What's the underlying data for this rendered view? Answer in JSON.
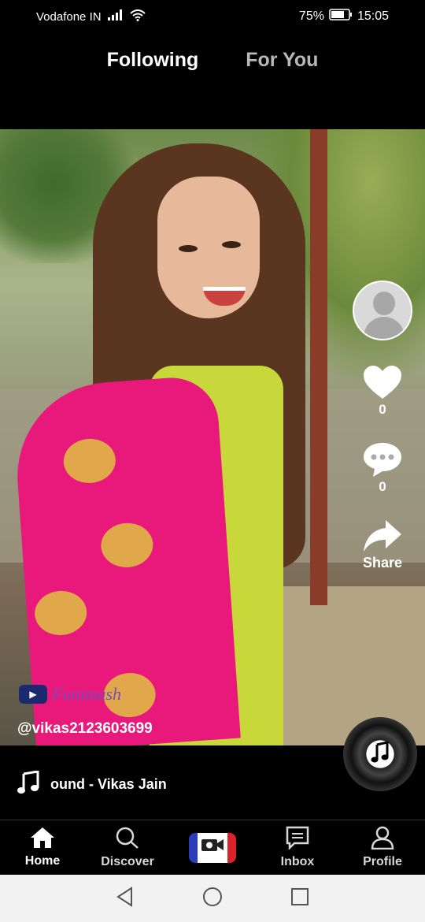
{
  "status_bar": {
    "carrier": "Vodafone IN",
    "battery": "75%",
    "time": "15:05"
  },
  "top_tabs": {
    "following": "Following",
    "for_you": "For You"
  },
  "video": {
    "watermark": "Funimash",
    "username": "@vikas2123603699"
  },
  "side_actions": {
    "likes": "0",
    "comments": "0",
    "share_label": "Share"
  },
  "sound": {
    "text": "ound - Vikas Jain"
  },
  "bottom_nav": {
    "home": "Home",
    "discover": "Discover",
    "inbox": "Inbox",
    "profile": "Profile"
  },
  "icons": [
    "signal-icon",
    "wifi-icon",
    "battery-icon",
    "heart-icon",
    "comment-icon",
    "share-icon",
    "music-note-icon",
    "home-icon",
    "search-icon",
    "camera-icon",
    "inbox-icon",
    "profile-icon",
    "back-icon",
    "home-circle-icon",
    "recents-icon"
  ],
  "colors": {
    "background": "#000000",
    "tab_inactive": "#b8b8b8",
    "camera_left": "#2b3cb8",
    "camera_right": "#d9232a"
  }
}
